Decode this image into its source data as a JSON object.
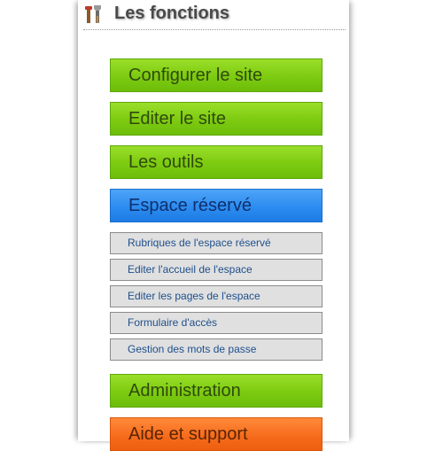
{
  "header": {
    "title": "Les fonctions",
    "icon": "tools-icon"
  },
  "menu": {
    "configure": "Configurer le site",
    "edit": "Editer le site",
    "tools": "Les outils",
    "reserved": "Espace réservé",
    "submenu": [
      "Rubriques de l'espace réservé",
      "Editer l'accueil de l'espace",
      "Editer les pages de l'espace",
      "Formulaire d'accès",
      "Gestion des mots de passe"
    ],
    "admin": "Administration",
    "help": "Aide et support"
  },
  "colors": {
    "green": "#7fcc12",
    "blue": "#2f8ef0",
    "orange": "#f56a1a",
    "submenu_bg": "#e0e0e0",
    "submenu_text": "#1e4f8c"
  }
}
